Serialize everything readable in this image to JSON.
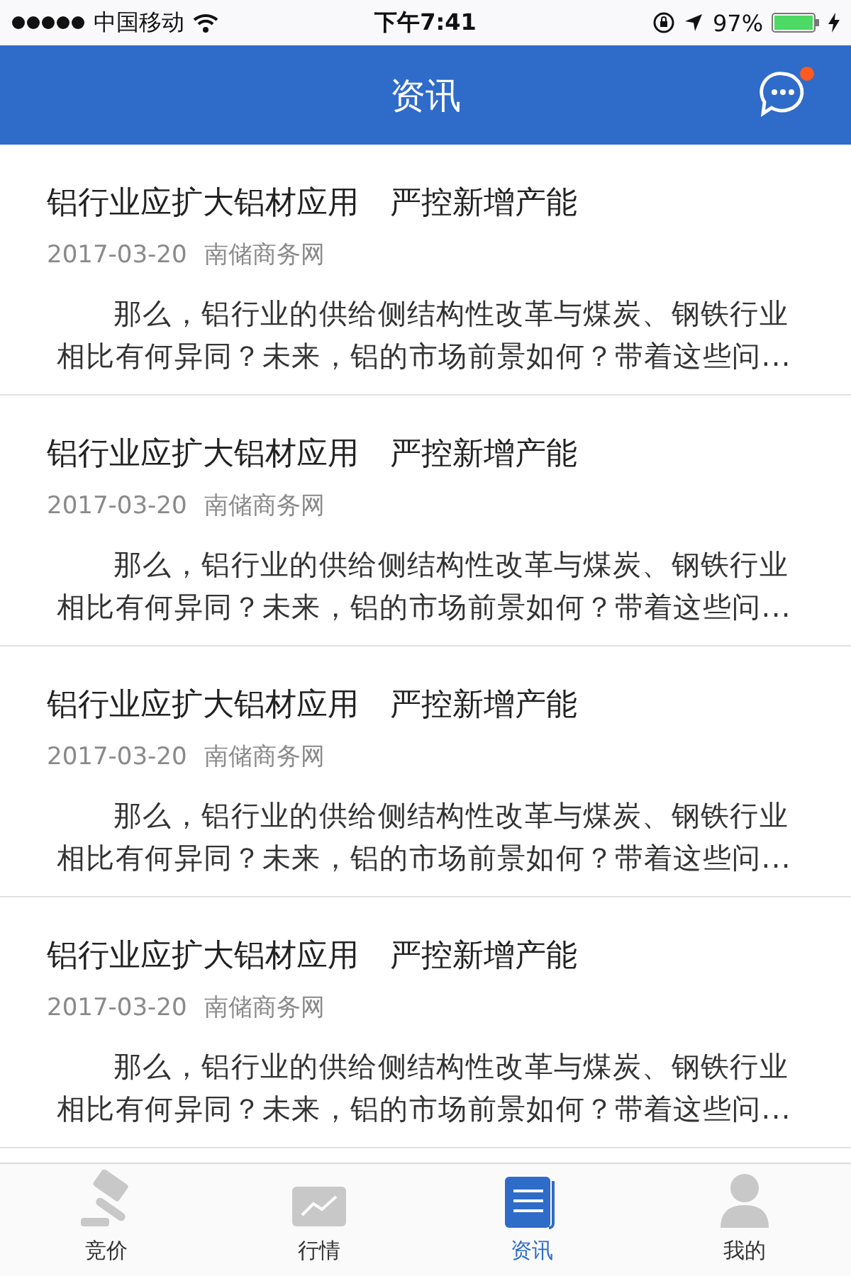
{
  "status_bar": {
    "carrier": "中国移动",
    "time": "下午7:41",
    "battery": "97%",
    "charging": true
  },
  "header": {
    "title": "资讯",
    "unread": true
  },
  "articles": [
    {
      "title": "铝行业应扩大铝材应用　严控新增产能",
      "date": "2017-03-20",
      "source": "南储商务网",
      "summary": "那么，铝行业的供给侧结构性改革与煤炭、钢铁行业相比有何异同？未来，铝的市场前景如何？带着这些问..."
    },
    {
      "title": "铝行业应扩大铝材应用　严控新增产能",
      "date": "2017-03-20",
      "source": "南储商务网",
      "summary": "那么，铝行业的供给侧结构性改革与煤炭、钢铁行业相比有何异同？未来，铝的市场前景如何？带着这些问..."
    },
    {
      "title": "铝行业应扩大铝材应用　严控新增产能",
      "date": "2017-03-20",
      "source": "南储商务网",
      "summary": "那么，铝行业的供给侧结构性改革与煤炭、钢铁行业相比有何异同？未来，铝的市场前景如何？带着这些问..."
    },
    {
      "title": "铝行业应扩大铝材应用　严控新增产能",
      "date": "2017-03-20",
      "source": "南储商务网",
      "summary": "那么，铝行业的供给侧结构性改革与煤炭、钢铁行业相比有何异同？未来，铝的市场前景如何？带着这些问..."
    }
  ],
  "tabs": [
    {
      "kind": "bid",
      "label": "竞价",
      "selected": false
    },
    {
      "kind": "market",
      "label": "行情",
      "selected": false
    },
    {
      "kind": "news",
      "label": "资讯",
      "selected": true
    },
    {
      "kind": "profile",
      "label": "我的",
      "selected": false
    }
  ]
}
